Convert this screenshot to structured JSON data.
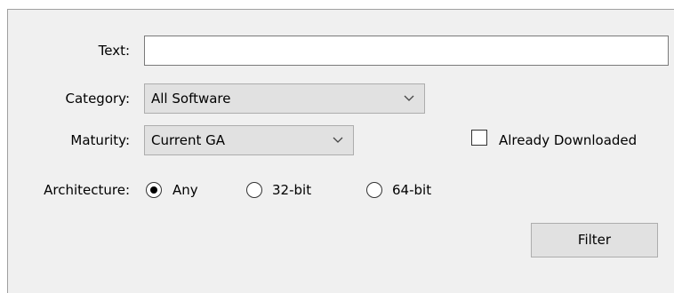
{
  "form": {
    "text": {
      "label": "Text:",
      "value": ""
    },
    "category": {
      "label": "Category:",
      "selected": "All Software",
      "icon": "chevron-down-icon"
    },
    "maturity": {
      "label": "Maturity:",
      "selected": "Current GA",
      "icon": "chevron-down-icon"
    },
    "already_downloaded": {
      "label": "Already Downloaded",
      "checked": false
    },
    "architecture": {
      "label": "Architecture:",
      "options": [
        {
          "label": "Any",
          "selected": true
        },
        {
          "label": "32-bit",
          "selected": false
        },
        {
          "label": "64-bit",
          "selected": false
        }
      ]
    },
    "filter_button": "Filter"
  },
  "colors": {
    "panel_bg": "#f0f0f0",
    "control_bg": "#e1e1e1",
    "control_border": "#adadad"
  }
}
